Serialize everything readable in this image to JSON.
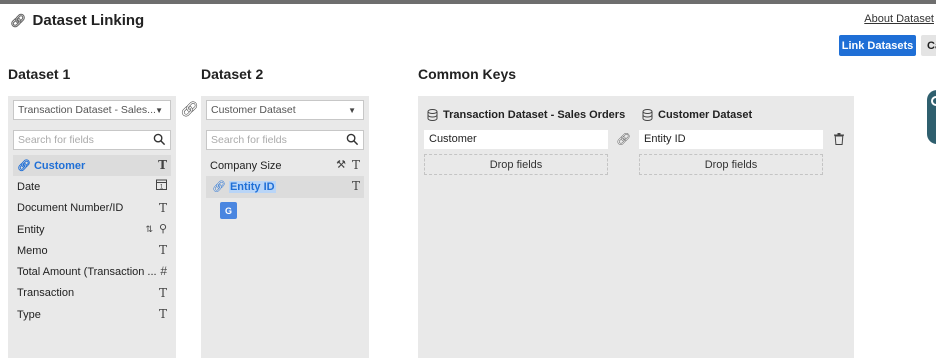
{
  "header": {
    "title": "Dataset Linking",
    "about_link": "About Dataset",
    "link_button": "Link Datasets",
    "cancel_button": "Ca"
  },
  "dataset1": {
    "heading": "Dataset 1",
    "selected": "Transaction Dataset - Sales...",
    "search_placeholder": "Search for fields",
    "fields": [
      {
        "label": "Customer",
        "icon": "T",
        "selected": true
      },
      {
        "label": "Date",
        "icon": "calendar"
      },
      {
        "label": "Document Number/ID",
        "icon": "T"
      },
      {
        "label": "Entity",
        "icon": "hierarchy"
      },
      {
        "label": "Memo",
        "icon": "T"
      },
      {
        "label": "Total Amount (Transaction ...",
        "icon": "#"
      },
      {
        "label": "Transaction",
        "icon": "T"
      },
      {
        "label": "Type",
        "icon": "T"
      }
    ]
  },
  "dataset2": {
    "heading": "Dataset 2",
    "selected": "Customer Dataset",
    "search_placeholder": "Search for fields",
    "fields": [
      {
        "label": "Company Size",
        "icon": "T"
      },
      {
        "label": "Entity ID",
        "icon": "T",
        "selected": true
      }
    ]
  },
  "common_keys": {
    "heading": "Common Keys",
    "left_dataset": "Transaction Dataset - Sales Orders",
    "right_dataset": "Customer Dataset",
    "left_key": "Customer",
    "right_key": "Entity ID",
    "drop_label": "Drop fields"
  },
  "colors": {
    "accent": "#1f6fd6",
    "panel": "#e9e9e9"
  }
}
